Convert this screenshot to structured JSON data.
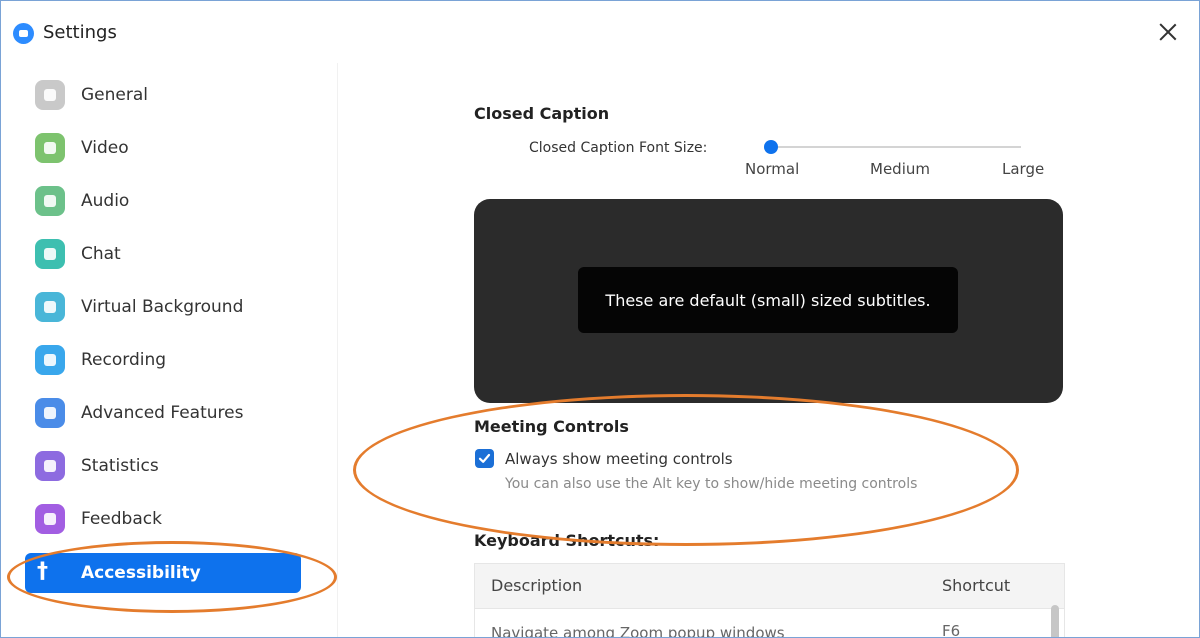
{
  "window": {
    "title": "Settings"
  },
  "sidebar": {
    "items": [
      {
        "label": "General",
        "icon": "gear-icon",
        "color": "#c9c9c9",
        "active": false
      },
      {
        "label": "Video",
        "icon": "video-camera-icon",
        "color": "#7dc36e",
        "active": false
      },
      {
        "label": "Audio",
        "icon": "headphones-icon",
        "color": "#6cc18a",
        "active": false
      },
      {
        "label": "Chat",
        "icon": "chat-bubble-icon",
        "color": "#3dbfb0",
        "active": false
      },
      {
        "label": "Virtual Background",
        "icon": "person-background-icon",
        "color": "#49b6d8",
        "active": false
      },
      {
        "label": "Recording",
        "icon": "record-icon",
        "color": "#39a7ec",
        "active": false
      },
      {
        "label": "Advanced Features",
        "icon": "sparkle-icon",
        "color": "#4a8ce8",
        "active": false
      },
      {
        "label": "Statistics",
        "icon": "bar-chart-icon",
        "color": "#8d6be0",
        "active": false
      },
      {
        "label": "Feedback",
        "icon": "smiley-icon",
        "color": "#a25ee2",
        "active": false
      },
      {
        "label": "Accessibility",
        "icon": "accessibility-icon",
        "color": "#0e72ed",
        "active": true
      }
    ]
  },
  "closed_caption": {
    "title": "Closed Caption",
    "font_size_label": "Closed Caption Font Size:",
    "options": [
      "Normal",
      "Medium",
      "Large"
    ],
    "selected": "Normal",
    "preview_text": "These are default (small) sized subtitles."
  },
  "meeting_controls": {
    "title": "Meeting Controls",
    "checkbox_label": "Always show meeting controls",
    "checked": true,
    "hint": "You can also use the Alt key to show/hide meeting controls"
  },
  "keyboard_shortcuts": {
    "title": "Keyboard Shortcuts:",
    "columns": [
      "Description",
      "Shortcut"
    ],
    "rows": [
      {
        "description": "Navigate among Zoom popup windows",
        "shortcut": "F6"
      }
    ]
  },
  "colors": {
    "accent": "#0e72ed",
    "annotation": "#e47c2d",
    "preview_bg": "#2b2b2b"
  }
}
